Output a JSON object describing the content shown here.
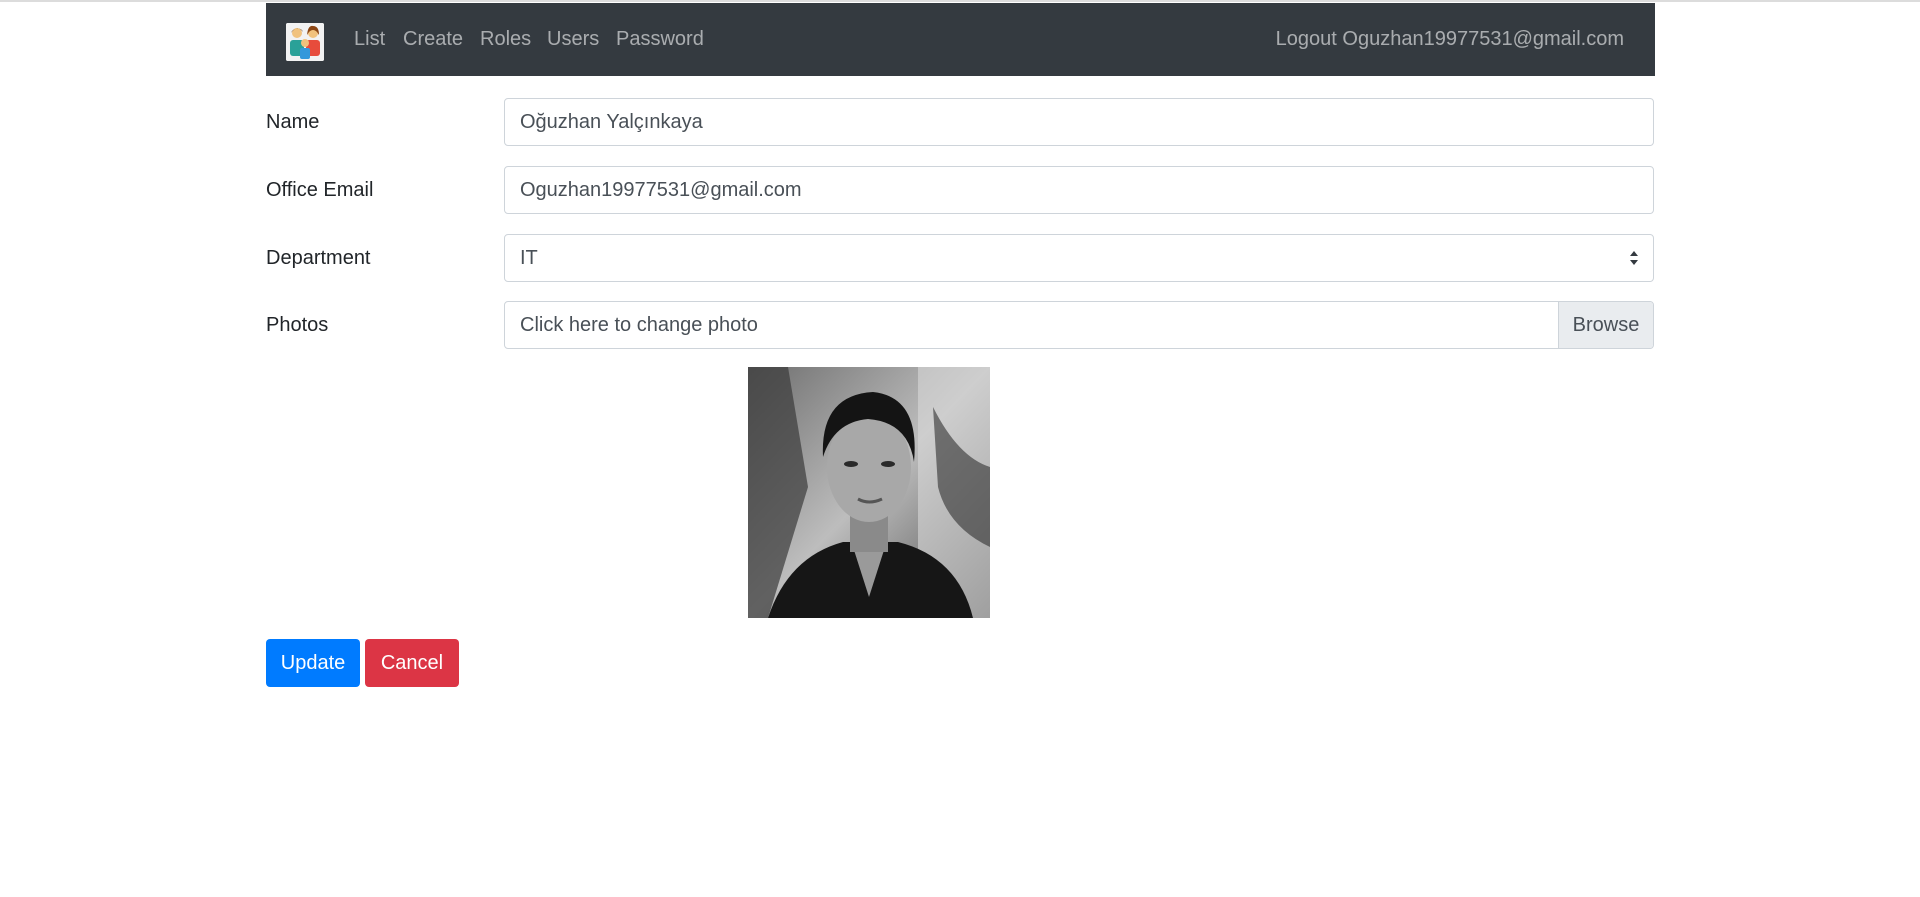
{
  "navbar": {
    "logo_icon": "team-people-icon",
    "links": [
      "List",
      "Create",
      "Roles",
      "Users",
      "Password"
    ],
    "logout_label": "Logout",
    "user_email": "Oguzhan19977531@gmail.com",
    "background_color": "#343a40"
  },
  "form": {
    "name": {
      "label": "Name",
      "value": "Oğuzhan Yalçınkaya"
    },
    "email": {
      "label": "Office Email",
      "value": "Oguzhan19977531@gmail.com"
    },
    "department": {
      "label": "Department",
      "selected": "IT"
    },
    "photos": {
      "label": "Photos",
      "placeholder": "Click here to change photo",
      "browse_label": "Browse"
    }
  },
  "actions": {
    "update_label": "Update",
    "cancel_label": "Cancel",
    "primary_color": "#007bff",
    "danger_color": "#dc3545"
  }
}
